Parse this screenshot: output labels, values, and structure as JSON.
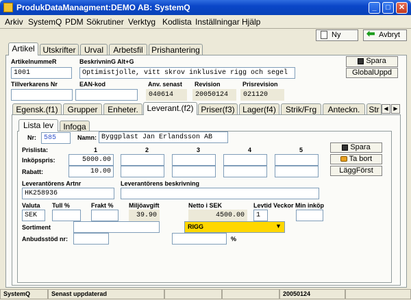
{
  "window": {
    "title": "ProdukDataManagment:DEMO AB: SystemQ"
  },
  "menu": [
    "Arkiv",
    "SystemQ",
    "PDM",
    "Sökrutiner",
    "Verktyg",
    "Kodlista",
    "Inställningar",
    "Hjälp"
  ],
  "toolbar": {
    "new_label": "Ny",
    "cancel_label": "Avbryt"
  },
  "top_tabs": [
    "Artikel",
    "Utskrifter",
    "Urval",
    "Arbetsfil",
    "Prishantering"
  ],
  "article": {
    "artnr_label": "ArtikelnummeR",
    "artnr_value": "1001",
    "desc_label": "BeskrivninG Alt+G",
    "desc_value": "Optimistjolle, vitt skrov inklusive rigg och segel",
    "tillverkare_label": "Tillverkarens Nr",
    "tillverkare_value": "",
    "ean_label": "EAN-kod",
    "ean_value": "",
    "anv_label": "Anv. senast",
    "anv_value": "040614",
    "revision_label": "Revision",
    "revision_value": "20050124",
    "prisrev_label": "Prisrevision",
    "prisrev_value": "021120",
    "save_label": "Spara",
    "globaluppd_label": "GlobalUppd"
  },
  "sub_tabs": [
    "Egensk.(f1)",
    "Grupper",
    "Enheter.",
    "Leverant.(f2)",
    "Priser(f3)",
    "Lager(f4)",
    "Strik/Frg",
    "Anteckn.",
    "Str"
  ],
  "inner_tabs": [
    "Lista lev",
    "Infoga"
  ],
  "supplier": {
    "nr_label": "Nr:",
    "nr_value": "585",
    "namn_label": "Namn:",
    "namn_value": "Byggplast Jan Erlandsson AB",
    "prislista_label": "Prislista:",
    "columns": [
      "1",
      "2",
      "3",
      "4",
      "5"
    ],
    "inkopspris_label": "Inköpspris:",
    "inkopspris_values": [
      "5000.00",
      "",
      "",
      "",
      ""
    ],
    "rabatt_label": "Rabatt:",
    "rabatt_values": [
      "10.00",
      "",
      "",
      "",
      ""
    ],
    "artnr_label": "Leverantörens Artnr",
    "artnr_value": "HK258936",
    "beskr_label": "Leverantörens beskrivning",
    "beskr_value": "",
    "valuta_label": "Valuta",
    "valuta_value": "SEK",
    "tull_label": "Tull %",
    "tull_value": "",
    "frakt_label": "Frakt %",
    "frakt_value": "",
    "miljo_label": "Miljöavgift",
    "miljo_value": "39.90",
    "netto_label": "Netto i SEK",
    "netto_value": "4500.00",
    "levtid_label": "Levtid Veckor",
    "levtid_value": "1",
    "mininkop_label": "Min inköp",
    "mininkop_value": "",
    "sortiment_label": "Sortiment",
    "sortiment_value": "",
    "sortiment_select": "RIGG",
    "anbud_label": "Anbudsstöd nr:",
    "anbud_value": "",
    "anbud_pct_value": "",
    "pct_label": "%",
    "save_label": "Spara",
    "delete_label": "Ta bort",
    "laggforst_label": "LäggFörst"
  },
  "status": {
    "app": "SystemQ",
    "message": "Senast uppdaterad",
    "seg3": "",
    "seg4": "",
    "date": "20050124",
    "seg6": ""
  },
  "colors": {
    "titlebar": "#0a46c8",
    "select_bg": "#ffd700",
    "nr_highlight": "#3355cc"
  }
}
